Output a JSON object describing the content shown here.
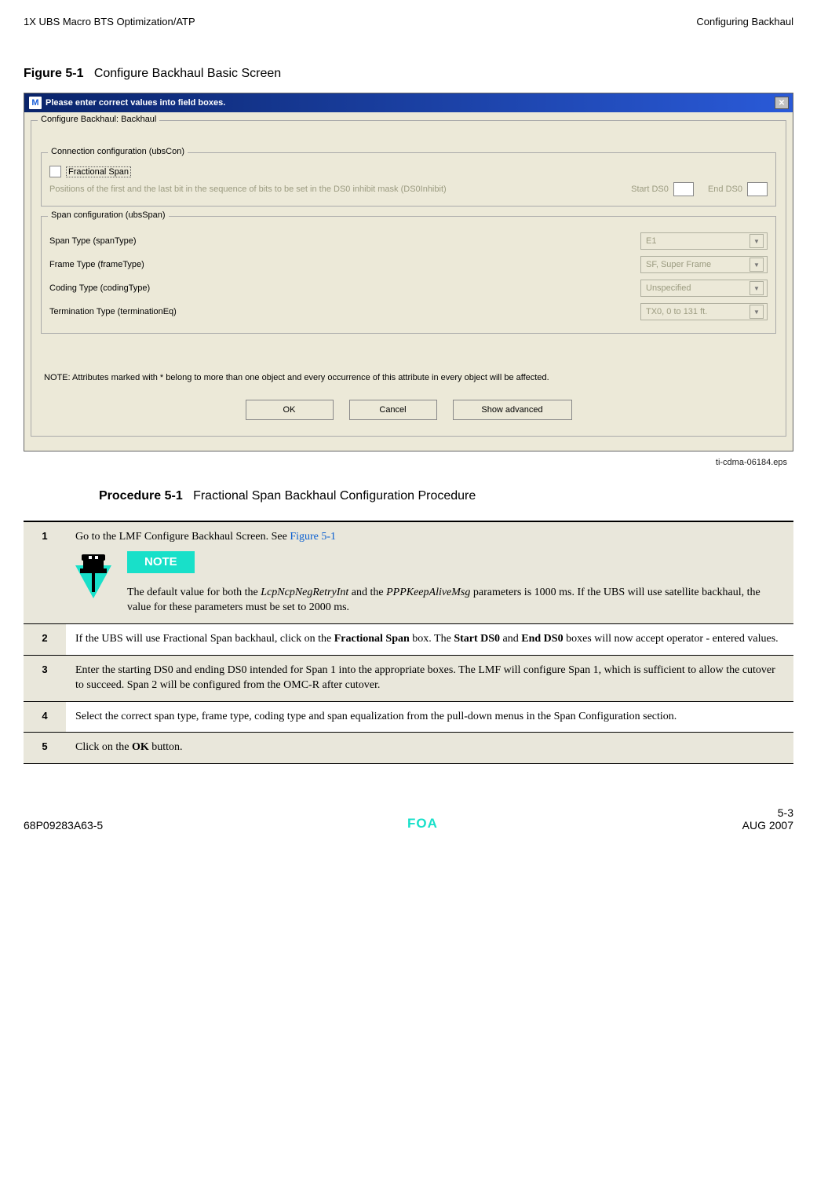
{
  "header": {
    "left": "1X UBS Macro BTS Optimization/ATP",
    "right": "Configuring Backhaul"
  },
  "figure": {
    "label": "Figure 5-1",
    "title": "Configure Backhaul Basic Screen"
  },
  "dialog": {
    "icon_letter": "M",
    "title": "Please enter correct values into field boxes.",
    "close": "✕",
    "group_legend": "Configure Backhaul: Backhaul",
    "conn_legend": "Connection configuration (ubsCon)",
    "frac_span_label": "Fractional Span",
    "hint_text": "Positions of the first and the last bit in the sequence of bits to be set in the DS0 inhibit mask (DS0Inhibit)",
    "start_ds0": "Start DS0",
    "end_ds0": "End DS0",
    "span_legend": "Span configuration (ubsSpan)",
    "rows": {
      "span_type": "Span Type (spanType)",
      "frame_type": "Frame Type (frameType)",
      "coding_type": "Coding Type (codingType)",
      "term_type": "Termination Type (terminationEq)"
    },
    "values": {
      "span_type": "E1",
      "frame_type": "SF, Super Frame",
      "coding_type": "Unspecified",
      "term_type": "TX0, 0 to 131 ft."
    },
    "note": "NOTE: Attributes marked with * belong to more than one object and every occurrence of this attribute in every object will be affected.",
    "buttons": {
      "ok": "OK",
      "cancel": "Cancel",
      "adv": "Show advanced"
    }
  },
  "eps": "ti-cdma-06184.eps",
  "procedure": {
    "label": "Procedure 5-1",
    "title": "Fractional Span Backhaul Configuration Procedure"
  },
  "steps": {
    "s1_intro": "Go to the LMF Configure Backhaul Screen.  See ",
    "s1_link": "Figure 5-1",
    "note_badge": "NOTE",
    "s1_note_a": "The default value for both the ",
    "s1_note_i1": "LcpNcpNegRetryInt",
    "s1_note_b": " and the ",
    "s1_note_i2": "PPPKeepAliveMsg",
    "s1_note_c": " parameters is 1000 ms.  If the UBS will use satellite backhaul, the value for these parameters must be set to 2000 ms.",
    "s2_a": "If the UBS will use Fractional Span backhaul, click on the ",
    "s2_b1": "Fractional Span",
    "s2_c": " box. The ",
    "s2_b2": "Start DS0",
    "s2_d": " and ",
    "s2_b3": "End DS0",
    "s2_e": " boxes will now accept operator - entered values.",
    "s3": "Enter the starting DS0 and ending DS0 intended for Span 1 into the appropriate boxes.  The LMF will configure Span 1, which is sufficient to allow the cutover to succeed.  Span 2 will be configured from the OMC-R after cutover.",
    "s4": "Select the correct span type, frame type, coding type and span equalization from the pull-down menus in the Span Configuration section.",
    "s5_a": "Click on the ",
    "s5_b": "OK",
    "s5_c": " button."
  },
  "footer": {
    "doc_id": "68P09283A63-5",
    "foa": "FOA",
    "page": "5-3",
    "date": "AUG 2007"
  }
}
